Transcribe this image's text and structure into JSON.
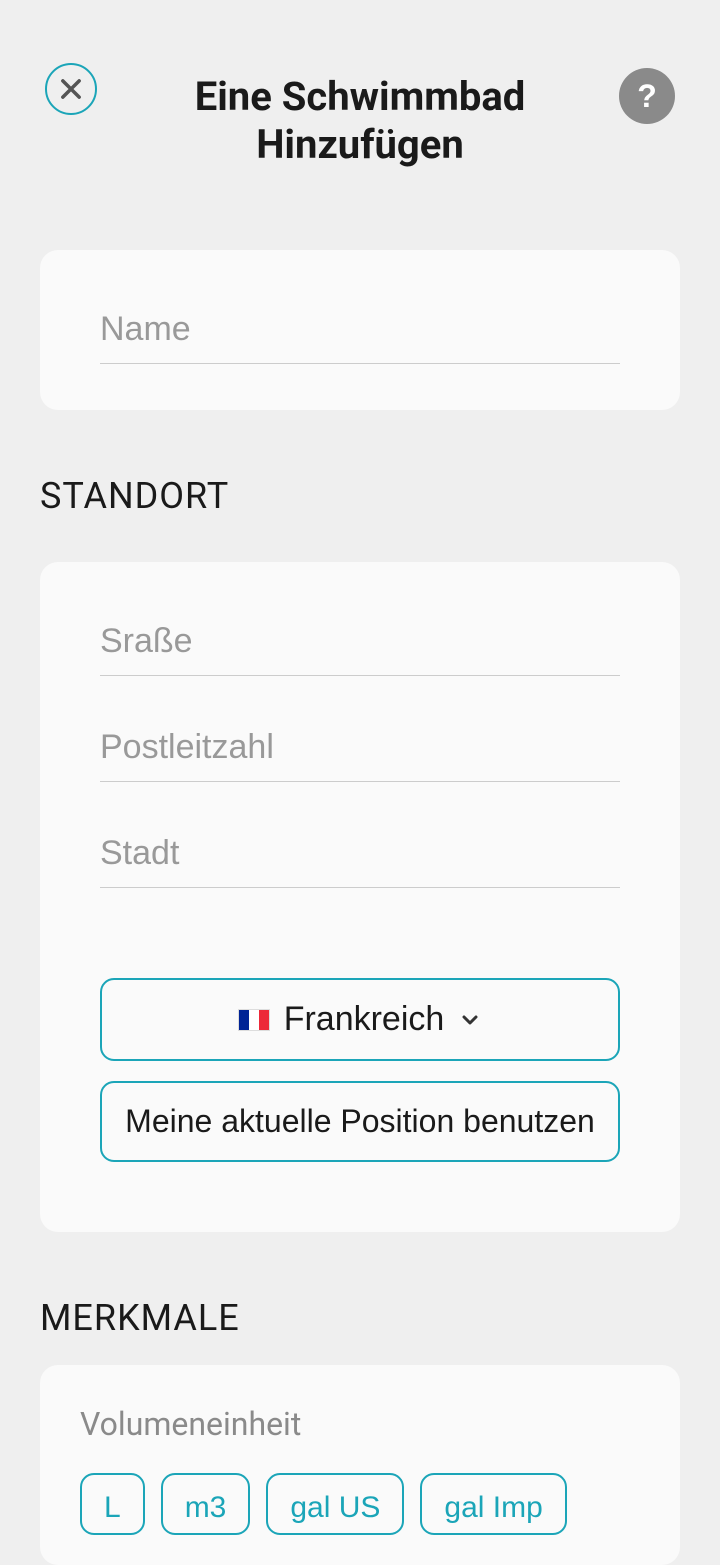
{
  "header": {
    "title": "Eine Schwimmbad Hinzufügen"
  },
  "name_section": {
    "placeholder": "Name"
  },
  "location": {
    "heading": "STANDORT",
    "street_placeholder": "Sraße",
    "postal_placeholder": "Postleitzahl",
    "city_placeholder": "Stadt",
    "country_label": "Frankreich",
    "use_location_label": "Meine aktuelle Position benutzen"
  },
  "features": {
    "heading": "MERKMALE",
    "volume_unit_label": "Volumeneinheit",
    "units": [
      "L",
      "m3",
      "gal US",
      "gal Imp"
    ]
  }
}
